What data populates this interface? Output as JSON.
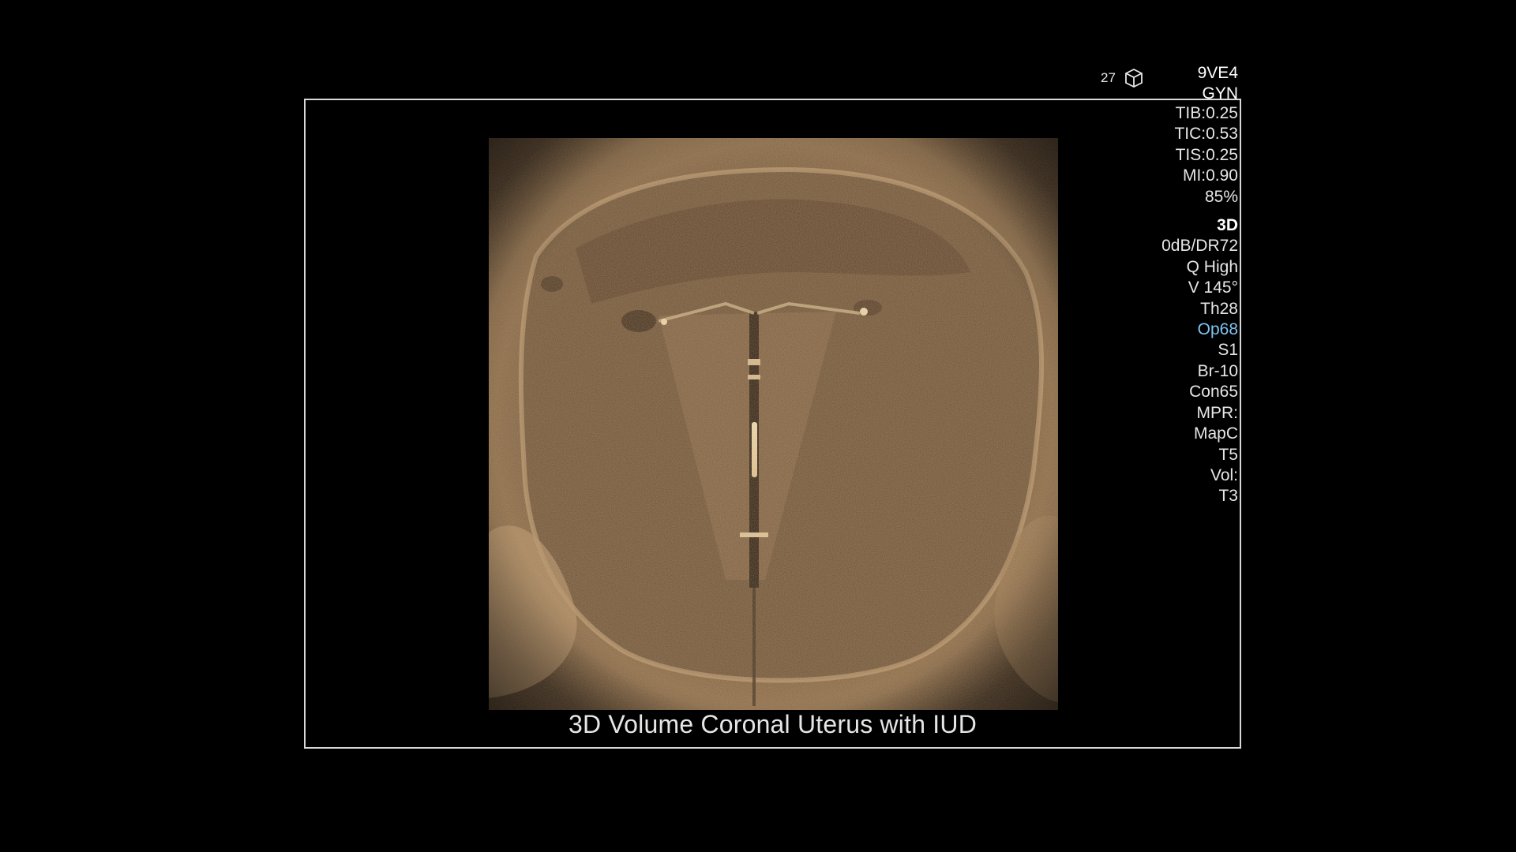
{
  "header": {
    "probe": "9VE4",
    "preset": "GYN",
    "frame_count": "27",
    "icon": "cube-icon"
  },
  "safety": {
    "tib": "TIB:0.25",
    "tic": "TIC:0.53",
    "tis": "TIS:0.25",
    "mi": "MI:0.90",
    "power": "85%"
  },
  "mode": {
    "label": "3D",
    "gain": "0dB/DR72",
    "quality": "Q High",
    "view_angle": "V 145°",
    "threshold": "Th28",
    "opacity": "Op68",
    "smooth": "S1",
    "brightness": "Br-10",
    "contrast": "Con65",
    "mpr": "MPR:",
    "map": "MapC",
    "mpr_tint": "T5",
    "vol": "Vol:",
    "vol_tint": "T3"
  },
  "image": {
    "caption": "3D Volume Coronal Uterus with IUD",
    "tint_color": "#8a6a45"
  },
  "colors": {
    "background": "#000000",
    "frame": "#d8d8d8",
    "accent": "#7fc4f2"
  }
}
